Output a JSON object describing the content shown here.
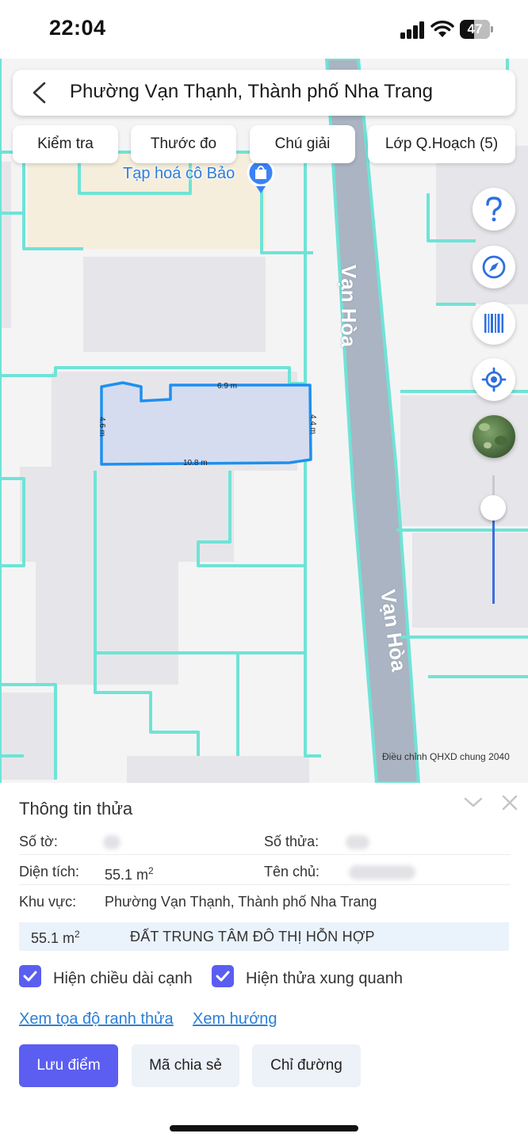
{
  "status_bar": {
    "time": "22:04",
    "battery": "47",
    "battery_level": 0.47
  },
  "header": {
    "title": "Phường Vạn Thạnh, Thành phố Nha Trang"
  },
  "toolbar": {
    "chips": [
      {
        "label": "Kiểm tra"
      },
      {
        "label": "Thước đo"
      },
      {
        "label": "Chú giải"
      },
      {
        "label": "Lớp Q.Hoạch (5)"
      }
    ]
  },
  "map": {
    "poi_label": "Tạp hoá cô Bảo",
    "road_label_1": "Vạn Hòa",
    "road_label_2": "Vạn Hòa",
    "edge_top": "6.9 m",
    "edge_bottom": "10.8 m",
    "edge_left": "4.6 m",
    "edge_right": "4.4 m",
    "credit": "Điều chỉnh QHXD chung 2040",
    "zoom_level": 0.75,
    "colors": {
      "parcel_outline": "#1e8ff0",
      "grid_lines": "#6fe3d6",
      "road": "#aab4c2",
      "parcel_fill": "#d5dcef"
    }
  },
  "side_buttons": [
    "help-icon",
    "compass-icon",
    "barcode-icon",
    "locate-icon",
    "satellite-layer-icon"
  ],
  "panel": {
    "title": "Thông tin thửa",
    "so_to_label": "Số tờ:",
    "so_thua_label": "Số thửa:",
    "dien_tich_label": "Diện tích:",
    "dien_tich_value": "55.1 m",
    "dien_tich_unit_sup": "2",
    "ten_chu_label": "Tên chủ:",
    "khu_vuc_label": "Khu vực:",
    "khu_vuc_value": "Phường Vạn Thạnh, Thành phố Nha Trang",
    "zone_area": "55.1 m",
    "zone_area_sup": "2",
    "zone_name": "ĐẤT TRUNG TÂM ĐÔ THỊ HỖN HỢP",
    "checkbox_edges": "Hiện chiều dài cạnh",
    "checkbox_neighbors": "Hiện thửa xung quanh",
    "link_coords": "Xem tọa độ ranh thửa",
    "link_direction": "Xem hướng",
    "btn_save": "Lưu điểm",
    "btn_share": "Mã chia sẻ",
    "btn_directions": "Chỉ đường",
    "accent_color": "#5b5ef0",
    "link_color": "#2b7fd6"
  }
}
